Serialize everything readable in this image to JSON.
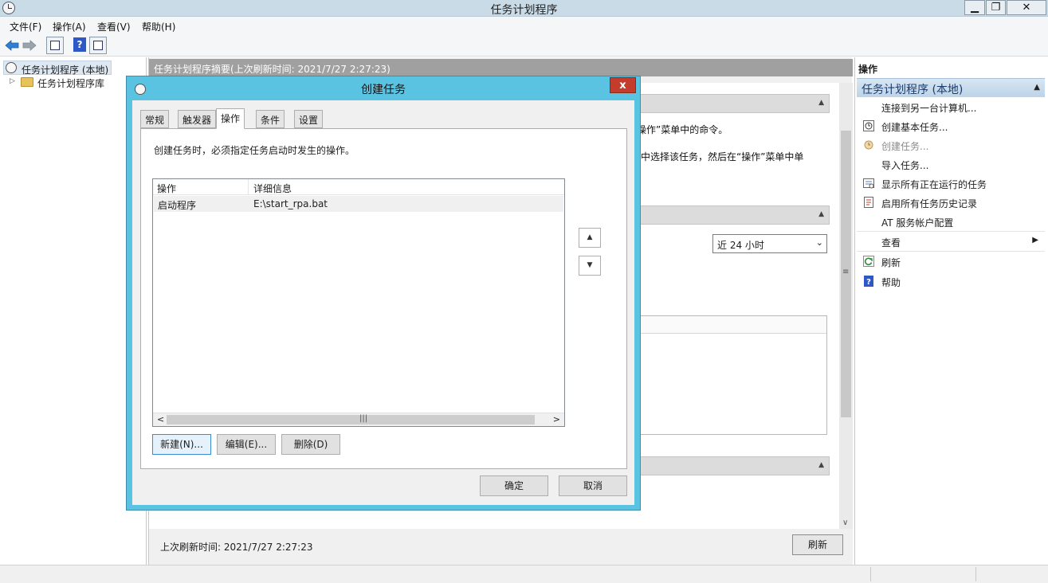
{
  "window": {
    "title": "任务计划程序"
  },
  "menu": [
    "文件(F)",
    "操作(A)",
    "查看(V)",
    "帮助(H)"
  ],
  "toolbar": {
    "help_glyph": "?"
  },
  "tree": {
    "root": "任务计划程序 (本地)",
    "library": "任务计划程序库"
  },
  "center": {
    "header": "任务计划程序摘要(上次刷新时间: 2021/7/27 2:27:23)",
    "text1": "操作”菜单中的命令。",
    "text2": "中选择该任务，然后在“操作”菜单中单",
    "history_select": "近 24 小时",
    "footer_text": "上次刷新时间: 2021/7/27 2:27:23",
    "refresh_label": "刷新"
  },
  "actions_pane": {
    "title": "操作",
    "group": "任务计划程序 (本地)",
    "items": [
      {
        "label": "连接到另一台计算机...",
        "icon": "none"
      },
      {
        "label": "创建基本任务...",
        "icon": "clock-wizard-icon"
      },
      {
        "label": "创建任务...",
        "icon": "task-icon",
        "disabled": true
      },
      {
        "label": "导入任务...",
        "icon": "none"
      },
      {
        "label": "显示所有正在运行的任务",
        "icon": "running-tasks-icon"
      },
      {
        "label": "启用所有任务历史记录",
        "icon": "history-icon"
      },
      {
        "label": "AT 服务帐户配置",
        "icon": "none"
      },
      {
        "label": "查看",
        "icon": "none",
        "submenu": true
      },
      {
        "label": "刷新",
        "icon": "refresh-icon"
      },
      {
        "label": "帮助",
        "icon": "help-icon"
      }
    ]
  },
  "dialog": {
    "title": "创建任务",
    "close_glyph": "x",
    "tabs": [
      "常规",
      "触发器",
      "操作",
      "条件",
      "设置"
    ],
    "active_tab": "操作",
    "description": "创建任务时，必须指定任务启动时发生的操作。",
    "columns": [
      "操作",
      "详细信息"
    ],
    "rows": [
      {
        "action": "启动程序",
        "detail": "E:\\start_rpa.bat"
      }
    ],
    "buttons": {
      "new": "新建(N)...",
      "edit": "编辑(E)...",
      "delete": "删除(D)",
      "ok": "确定",
      "cancel": "取消"
    }
  },
  "colors": {
    "dialog_frame": "#5bc3e2",
    "close_button": "#c43c2c",
    "center_header": "#a0a0a0"
  }
}
